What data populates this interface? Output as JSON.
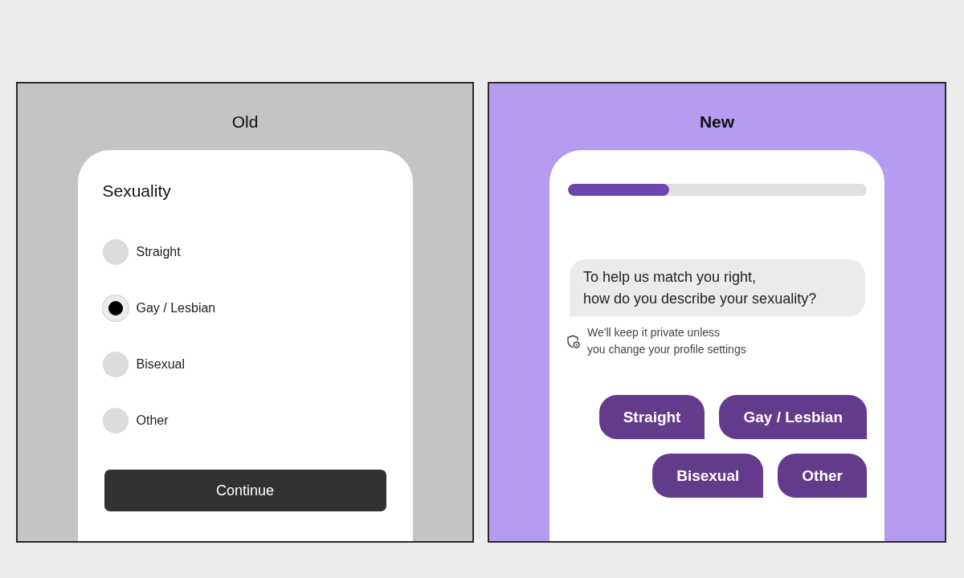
{
  "panels": [
    {
      "kind": "old",
      "title": "Old",
      "heading": "Sexuality",
      "options": [
        {
          "label": "Straight",
          "selected": false
        },
        {
          "label": "Gay / Lesbian",
          "selected": true
        },
        {
          "label": "Bisexual",
          "selected": false
        },
        {
          "label": "Other",
          "selected": false
        }
      ],
      "continue_button": "Continue"
    },
    {
      "kind": "new",
      "title": "New",
      "progress": {
        "level": 0.34
      },
      "question": "To help us match you right,\nhow do you describe your sexuality?",
      "privacy_note": "We'll keep it private unless\nyou change your profile settings",
      "options": [
        {
          "label": "Straight",
          "selected": false
        },
        {
          "label": "Gay / Lesbian",
          "selected": false
        },
        {
          "label": "Bisexual",
          "selected": false
        },
        {
          "label": "Other",
          "selected": false
        }
      ]
    }
  ]
}
